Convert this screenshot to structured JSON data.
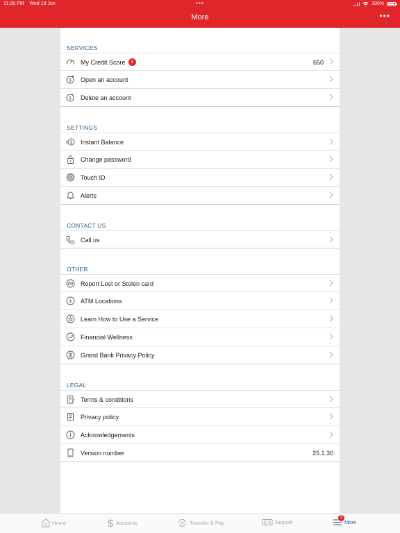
{
  "status_bar": {
    "time": "11:28 PM",
    "date": "Wed 18 Jun",
    "dots": "•••",
    "battery": "100%"
  },
  "header": {
    "title": "More",
    "menu_icon": "ellipsis-icon",
    "menu_label": "•••"
  },
  "colors": {
    "brand_red": "#e0262b",
    "section_blue": "#2c5f8a"
  },
  "sections": {
    "services": {
      "title": "SERVICES",
      "items": [
        {
          "label": "My Credit Score",
          "badge": "3",
          "value": "650",
          "icon": "speedometer-icon"
        },
        {
          "label": "Open an account",
          "icon": "dollar-plus-icon"
        },
        {
          "label": "Delete an account",
          "icon": "dollar-minus-icon"
        }
      ]
    },
    "settings": {
      "title": "SETTINGS",
      "items": [
        {
          "label": "Instant Balance",
          "icon": "instant-balance-icon"
        },
        {
          "label": "Change password",
          "icon": "lock-icon"
        },
        {
          "label": "Touch ID",
          "icon": "fingerprint-icon"
        },
        {
          "label": "Alerts",
          "icon": "bell-icon"
        }
      ]
    },
    "contact": {
      "title": "CONTACT US",
      "items": [
        {
          "label": "Call us",
          "icon": "phone-icon"
        }
      ]
    },
    "other": {
      "title": "OTHER",
      "items": [
        {
          "label": "Report Lost or Stolen card",
          "icon": "card-icon"
        },
        {
          "label": "ATM Locations",
          "icon": "atm-icon"
        },
        {
          "label": "Learn How to Use a Service",
          "icon": "star-icon"
        },
        {
          "label": "Financial Wellness",
          "icon": "wellness-icon"
        },
        {
          "label": "Grand Bank Privacy Policy",
          "icon": "bank-icon"
        }
      ]
    },
    "legal": {
      "title": "LEGAL",
      "items": [
        {
          "label": "Terms & conditions",
          "icon": "document-pen-icon"
        },
        {
          "label": "Privacy policy",
          "icon": "document-icon"
        },
        {
          "label": "Acknowledgements",
          "icon": "info-icon"
        },
        {
          "label": "Version number",
          "value": "25.1.30",
          "icon": "phone-device-icon"
        }
      ]
    }
  },
  "tabs": [
    {
      "label": "Home",
      "icon": "home-icon"
    },
    {
      "label": "Accounts",
      "icon": "dollar-icon"
    },
    {
      "label": "Transfer & Pay",
      "icon": "transfer-icon"
    },
    {
      "label": "Deposit",
      "icon": "deposit-icon"
    },
    {
      "label": "More",
      "icon": "menu-icon",
      "badge": "3",
      "active": true
    }
  ]
}
